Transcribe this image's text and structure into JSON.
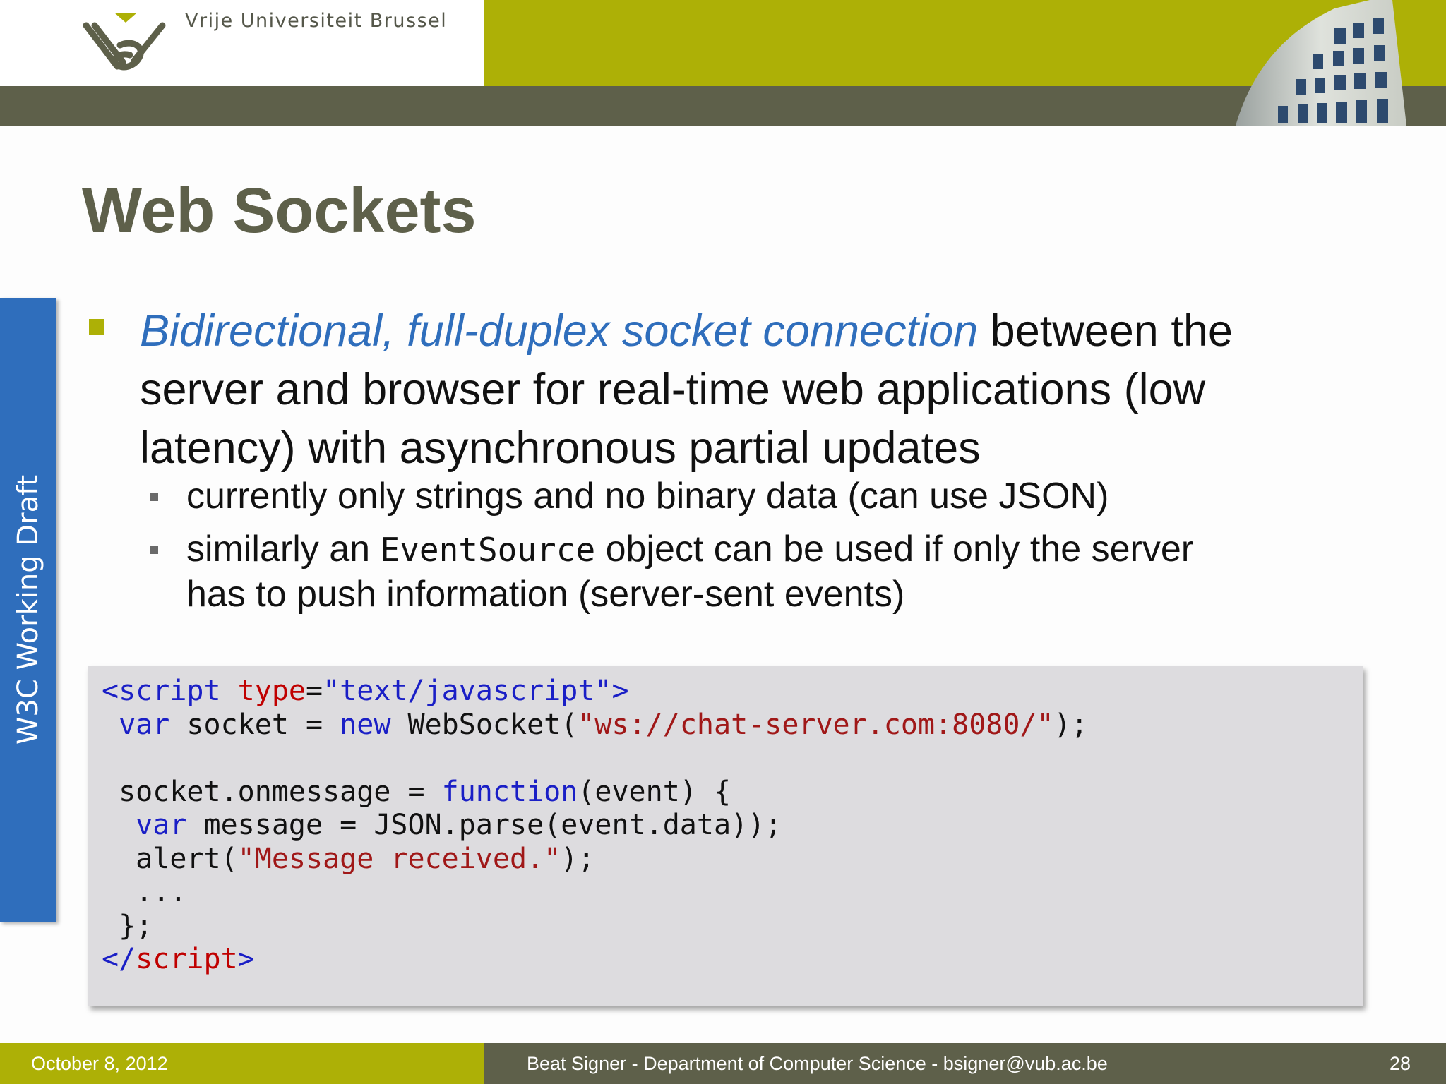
{
  "header": {
    "university_name": "Vrije Universiteit  Brussel",
    "logo_icon": "vub-logo",
    "photo_icon": "building-photo",
    "colors": {
      "olive": "#adb006",
      "dark_olive": "#5e604a",
      "tab_blue": "#2f6ebc"
    }
  },
  "side_tab": {
    "label": "W3C Working Draft"
  },
  "slide": {
    "title": "Web Sockets",
    "bullet": {
      "highlight": "Bidirectional, full-duplex socket connection",
      "rest_line1": " between the",
      "rest_line2": "server and browser for real-time web applications (low",
      "rest_line3": "latency) with asynchronous partial updates"
    },
    "sub_bullets": [
      {
        "text": "currently only strings and no binary data (can use JSON)"
      },
      {
        "before": "similarly an ",
        "code": "EventSource",
        "after": " object can be used if only the server",
        "line2": "has to push information (server-sent events)"
      }
    ]
  },
  "code": {
    "l1_open": "<script",
    "l1_attr": "type",
    "l1_eq": "=",
    "l1_val": "\"text/javascript\"",
    "l1_close": ">",
    "l2_indent": " ",
    "l2_kw": "var",
    "l2_mid": " socket = ",
    "l2_new": "new",
    "l2_call": " WebSocket(",
    "l2_str": "\"ws://chat-server.com:8080/\"",
    "l2_end": ");",
    "l4_a": " socket.onmessage = ",
    "l4_fn": "function",
    "l4_b": "(event) {",
    "l5_indent": "  ",
    "l5_kw": "var",
    "l5_rest": " message = JSON.parse(event.data));",
    "l6_a": "  alert(",
    "l6_str": "\"Message received.\"",
    "l6_b": ");",
    "l7": "  ...",
    "l8": " };",
    "l9_open": "</",
    "l9_tag": "script",
    "l9_close": ">"
  },
  "footer": {
    "date": "October 8, 2012",
    "credit": "Beat Signer - Department of Computer Science - bsigner@vub.ac.be",
    "page": "28"
  }
}
